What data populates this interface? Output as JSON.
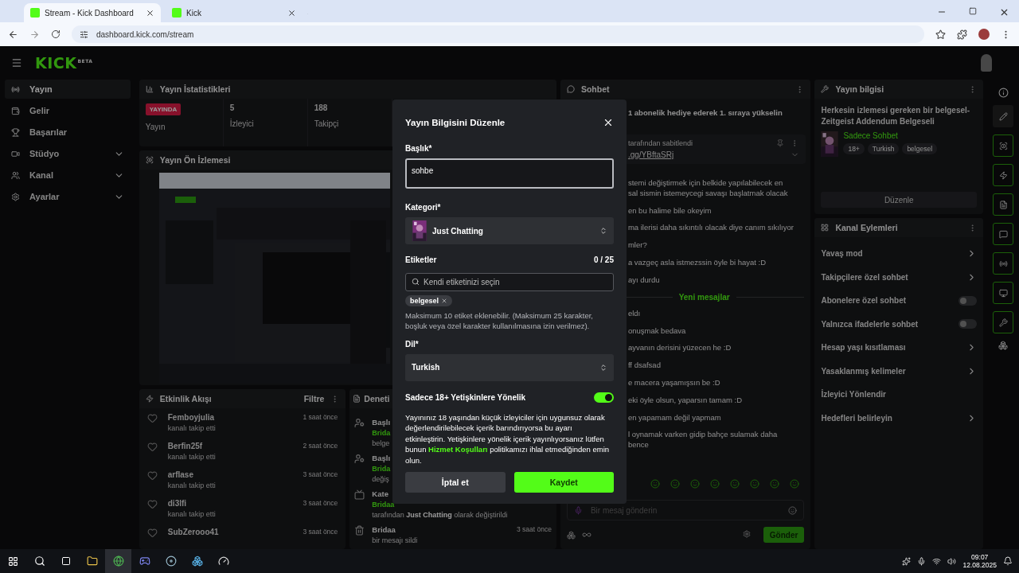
{
  "browser": {
    "tabs": [
      {
        "title": "Stream - Kick Dashboard",
        "selected": true
      },
      {
        "title": "Kick",
        "selected": false
      }
    ],
    "url": "dashboard.kick.com/stream"
  },
  "header": {
    "logo": "KICK",
    "logo_badge": "BETA"
  },
  "sidebar": {
    "items": [
      {
        "label": "Yayın",
        "selected": true,
        "expandable": false
      },
      {
        "label": "Gelir",
        "selected": false,
        "expandable": false
      },
      {
        "label": "Başarılar",
        "selected": false,
        "expandable": false
      },
      {
        "label": "Stüdyo",
        "selected": false,
        "expandable": true
      },
      {
        "label": "Kanal",
        "selected": false,
        "expandable": true
      },
      {
        "label": "Ayarlar",
        "selected": false,
        "expandable": true
      }
    ]
  },
  "stats": {
    "title": "Yayın İstatistikleri",
    "cells": [
      {
        "kind": "badge",
        "value": "YAYINDA",
        "label": "Yayın"
      },
      {
        "kind": "number",
        "value": "5",
        "label": "İzleyici"
      },
      {
        "kind": "number",
        "value": "188",
        "label": "Takipçi"
      }
    ]
  },
  "preview": {
    "title": "Yayın Ön İzlemesi"
  },
  "activity": {
    "title": "Etkinlik Akışı",
    "filter": "Filtre",
    "events": [
      {
        "user": "Femboyjulia",
        "action": "kanalı takip etti",
        "time": "1 saat önce"
      },
      {
        "user": "Berfin25f",
        "action": "kanalı takip etti",
        "time": "2 saat önce"
      },
      {
        "user": "arflase",
        "action": "kanalı takip etti",
        "time": "3 saat önce"
      },
      {
        "user": "di3lfi",
        "action": "kanalı takip etti",
        "time": "3 saat önce"
      },
      {
        "user": "SubZerooo41",
        "time": "3 saat önce"
      }
    ]
  },
  "moderation": {
    "title": "Deneti",
    "entries": [
      {
        "title": "Başlı",
        "user": "Brida",
        "detail": "belge"
      },
      {
        "title": "Başlı",
        "user": "Brida",
        "detail": "değiş"
      },
      {
        "title": "Kate",
        "user": "Bridaa",
        "detail": "tarafından **Just Chatting** olarak değiştirildi"
      },
      {
        "title": "Bridaa",
        "detail": "bir mesajı sildi",
        "time": "3 saat önce"
      }
    ]
  },
  "chat": {
    "title": "Sohbet",
    "promo": "1 abonelik hediye ederek 1. sıraya yükselin",
    "pinned": {
      "by": "tarafından sabitlendi",
      "link": ".gg/YBftaSRj"
    },
    "messages": [
      {
        "kind": "message",
        "lines": [
          "stemi değiştirmek için belkide yapılabilecek en",
          "sal sismin istemeycegi savaşı başlatmak olacak"
        ]
      },
      {
        "kind": "message",
        "lines": [
          "en bu halime bile okeyim"
        ]
      },
      {
        "kind": "message",
        "lines": [
          "ma ilerisi daha sıkıntılı olacak diye canım sıkılıyor"
        ]
      },
      {
        "kind": "message",
        "lines": [
          "mler?"
        ]
      },
      {
        "kind": "message",
        "lines": [
          "a vazgeç asla istmezssin öyle bi hayat :D"
        ]
      },
      {
        "kind": "message",
        "lines": [
          "ayı durdu"
        ]
      },
      {
        "kind": "divider",
        "lines": [
          "Yeni mesajlar"
        ]
      },
      {
        "kind": "message",
        "lines": [
          "eldı"
        ]
      },
      {
        "kind": "message",
        "lines": [
          "onuşmak bedava"
        ]
      },
      {
        "kind": "message",
        "lines": [
          "ayvanın derisini yüzecen he :D"
        ]
      },
      {
        "kind": "message",
        "lines": [
          "ff dsafsad"
        ]
      },
      {
        "kind": "message",
        "lines": [
          "e macera yaşamışsın be :D"
        ]
      },
      {
        "kind": "message",
        "lines": [
          "eki öyle olsun, yaparsın tamam :D"
        ]
      },
      {
        "kind": "message",
        "lines": [
          "en yapamam değil yapmam"
        ]
      },
      {
        "kind": "message",
        "lines": [
          "l oynamak varken gidip bahçe sulamak daha",
          "bence"
        ]
      }
    ],
    "input_placeholder": "Bir mesaj gönderin",
    "send": "Gönder"
  },
  "stream_info": {
    "title": "Yayın bilgisi",
    "stream_title": "Herkesin izlemesi gereken bir belgesel-Zeitgeist Addendum Belgeseli",
    "category": "Sadece Sohbet",
    "tags": [
      "18+",
      "Turkish",
      "belgesel"
    ],
    "edit": "Düzenle"
  },
  "channel_actions": {
    "title": "Kanal Eylemleri",
    "items": [
      {
        "label": "Yavaş mod",
        "kind": "link"
      },
      {
        "label": "Takipçilere özel sohbet",
        "kind": "link"
      },
      {
        "label": "Abonelere özel sohbet",
        "kind": "toggle",
        "on": false
      },
      {
        "label": "Yalnızca ifadelerle sohbet",
        "kind": "toggle",
        "on": false
      },
      {
        "label": "Hesap yaşı kısıtlaması",
        "kind": "link"
      },
      {
        "label": "Yasaklanmış kelimeler",
        "kind": "link"
      },
      {
        "label": "İzleyici Yönlendir",
        "kind": "plain"
      },
      {
        "label": "Hedefleri belirleyin",
        "kind": "link"
      }
    ]
  },
  "modal": {
    "title": "Yayın Bilgisini Düzenle",
    "title_label": "Başlık*",
    "title_value": "sohbe",
    "category_label": "Kategori*",
    "category": "Just Chatting",
    "tags_label": "Etiketler",
    "tags_count": "0 / 25",
    "tags_placeholder": "Kendi etiketinizi seçin",
    "tags": [
      "belgesel"
    ],
    "tags_help": "Maksimum 10 etiket eklenebilir. (Maksimum 25 karakter, boşluk veya özel karakter kullanılmasına izin verilmez).",
    "language_label": "Dil*",
    "language": "Turkish",
    "mature_label": "Sadece 18+ Yetişkinlere Yönelik",
    "mature_on": true,
    "mature_text": "Yayınınız 18 yaşından küçük izleyiciler için uygunsuz olarak değerlendirilebilecek içerik barındırıyorsa bu ayarı etkinleştirin. Yetişkinlere yönelik içerik yayınlıyorsanız lütfen bunun ",
    "mature_link": "Hizmet Koşulları",
    "mature_text_end": " politikamızı ihlal etmediğinden emin olun.",
    "cancel": "İptal et",
    "save": "Kaydet"
  },
  "taskbar": {
    "time": "09:07",
    "date": "12.08.2025"
  }
}
